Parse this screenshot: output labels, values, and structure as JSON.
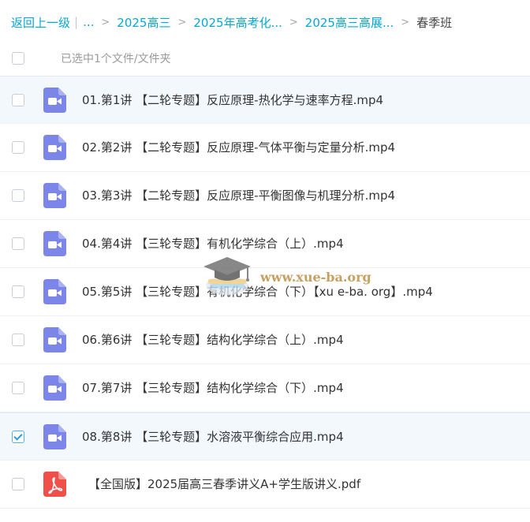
{
  "breadcrumb": {
    "back": "返回上一级",
    "ellipsis": "...",
    "crumbs": [
      "2025高三",
      "2025年高考化...",
      "2025高三高展..."
    ],
    "current": "春季班"
  },
  "selection": {
    "status": "已选中1个文件/文件夹"
  },
  "files": [
    {
      "name": "01.第1讲 【二轮专题】反应原理-热化学与速率方程.mp4",
      "type": "video",
      "checked": false
    },
    {
      "name": "02.第2讲 【二轮专题】反应原理-气体平衡与定量分析.mp4",
      "type": "video",
      "checked": false
    },
    {
      "name": "03.第3讲 【二轮专题】反应原理-平衡图像与机理分析.mp4",
      "type": "video",
      "checked": false
    },
    {
      "name": "04.第4讲 【三轮专题】有机化学综合（上）.mp4",
      "type": "video",
      "checked": false
    },
    {
      "name": "05.第5讲 【三轮专题】有机化学综合（下）【xu e-ba. org】.mp4",
      "type": "video",
      "checked": false
    },
    {
      "name": "06.第6讲 【三轮专题】结构化学综合（上）.mp4",
      "type": "video",
      "checked": false
    },
    {
      "name": "07.第7讲 【三轮专题】结构化学综合（下）.mp4",
      "type": "video",
      "checked": false
    },
    {
      "name": "08.第8讲 【三轮专题】水溶液平衡综合应用.mp4",
      "type": "video",
      "checked": true
    },
    {
      "name": "【全国版】2025届高三春季讲义A+学生版讲义.pdf",
      "type": "pdf",
      "checked": false
    }
  ],
  "watermark": {
    "text": "www.xue-ba.org"
  },
  "icons": {
    "video": "video-file-icon",
    "pdf": "pdf-file-icon"
  },
  "colors": {
    "link": "#06a7d6",
    "video_icon": "#7b86e8",
    "pdf_icon": "#f0504a",
    "selected_row": "#f2f8fc",
    "check": "#2b9ce0"
  }
}
